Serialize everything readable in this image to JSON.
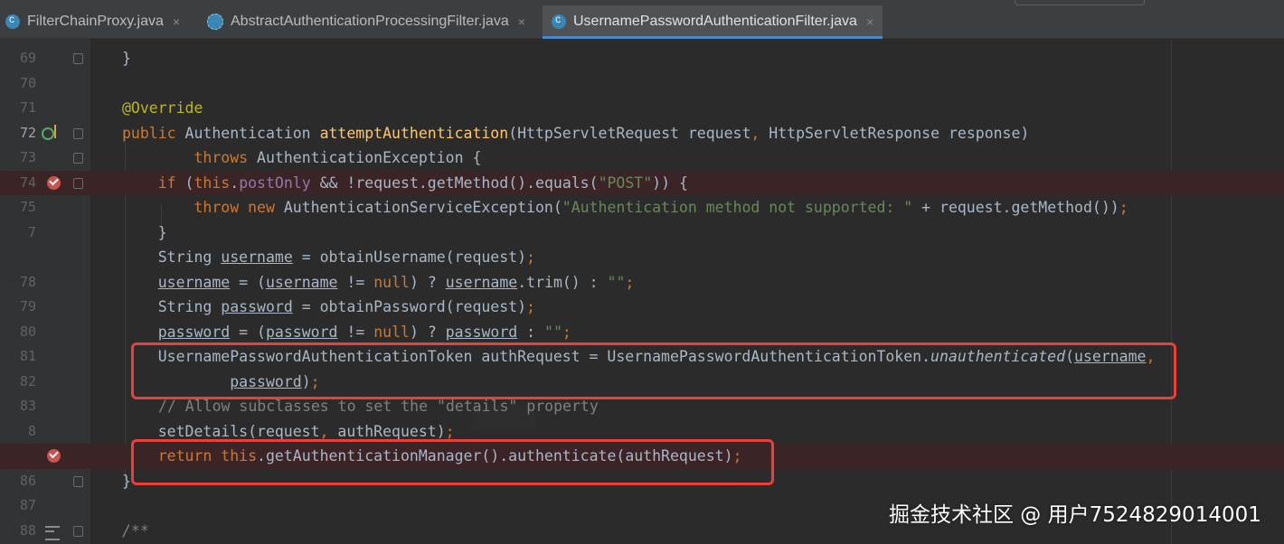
{
  "tabs": [
    {
      "label": "FilterChainProxy.java",
      "icon": "java-class-icon"
    },
    {
      "label": "AbstractAuthenticationProcessingFilter.java",
      "icon": "abstract-class-icon"
    },
    {
      "label": "UsernamePasswordAuthenticationFilter.java",
      "icon": "java-class-icon",
      "active": true
    }
  ],
  "close_glyph": "×",
  "lines": [
    {
      "n": "69",
      "text": "}"
    },
    {
      "n": "70",
      "text": ""
    },
    {
      "n": "71",
      "text": "@Override"
    },
    {
      "n": "72",
      "text": "public Authentication attemptAuthentication(HttpServletRequest request, HttpServletResponse response)"
    },
    {
      "n": "73",
      "text": "throws AuthenticationException {"
    },
    {
      "n": "74",
      "text": "if (this.postOnly && !request.getMethod().equals(\"POST\")) {"
    },
    {
      "n": "75",
      "text": "throw new AuthenticationServiceException(\"Authentication method not supported: \" + request.getMethod());"
    },
    {
      "n": "7",
      "text": "}"
    },
    {
      "n": "",
      "text": "String username = obtainUsername(request);"
    },
    {
      "n": "78",
      "text": "username = (username != null) ? username.trim() : \"\";"
    },
    {
      "n": "79",
      "text": "String password = obtainPassword(request);"
    },
    {
      "n": "80",
      "text": "password = (password != null) ? password : \"\";"
    },
    {
      "n": "81",
      "text": "UsernamePasswordAuthenticationToken authRequest = UsernamePasswordAuthenticationToken.unauthenticated(username,"
    },
    {
      "n": "82",
      "text": "password);"
    },
    {
      "n": "83",
      "text": "// Allow subclasses to set the \"details\" property"
    },
    {
      "n": "8",
      "text": "setDetails(request, authRequest);"
    },
    {
      "n": "",
      "text": "return this.getAuthenticationManager().authenticate(authRequest);"
    },
    {
      "n": "86",
      "text": "}"
    },
    {
      "n": "87",
      "text": ""
    },
    {
      "n": "88",
      "text": "/**"
    }
  ],
  "watermark": "掘金技术社区 @ 用户7524829014001",
  "colors": {
    "background": "#2b2b2b",
    "keyword": "#cc7832",
    "annotation": "#bbb529",
    "method": "#ffc66d",
    "field": "#9876aa",
    "string": "#6a8759",
    "comment": "#808080",
    "highlight_box": "#e8413b",
    "breakpoint": "#c75450"
  }
}
